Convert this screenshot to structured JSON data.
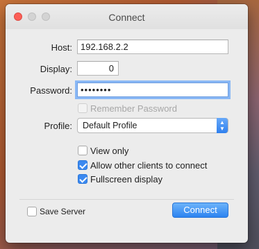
{
  "window": {
    "title": "Connect"
  },
  "form": {
    "host_label": "Host:",
    "host_value": "192.168.2.2",
    "display_label": "Display:",
    "display_value": "0",
    "password_label": "Password:",
    "password_value": "••••••••",
    "remember_label": "Remember Password",
    "remember_checked": false,
    "remember_enabled": false,
    "profile_label": "Profile:",
    "profile_value": "Default Profile"
  },
  "options": [
    {
      "label": "View only",
      "checked": false
    },
    {
      "label": "Allow other clients to connect",
      "checked": true
    },
    {
      "label": "Fullscreen display",
      "checked": true
    }
  ],
  "footer": {
    "save_server_label": "Save Server",
    "save_server_checked": false,
    "connect_label": "Connect"
  },
  "colors": {
    "accent": "#3b89f0",
    "close": "#fc5f57"
  }
}
